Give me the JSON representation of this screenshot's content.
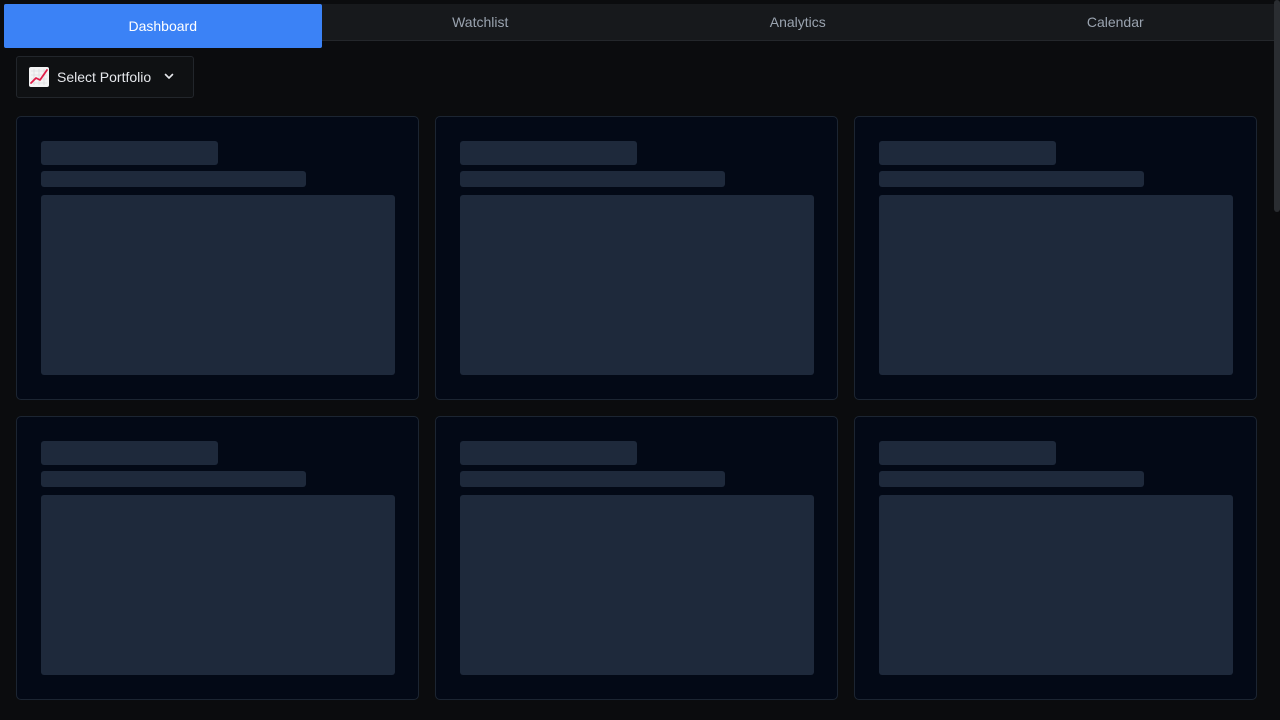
{
  "tabs": [
    {
      "label": "Dashboard",
      "active": true
    },
    {
      "label": "Watchlist",
      "active": false
    },
    {
      "label": "Analytics",
      "active": false
    },
    {
      "label": "Calendar",
      "active": false
    }
  ],
  "portfolio_select": {
    "label": "Select Portfolio",
    "icon": "chart-increasing-icon"
  },
  "colors": {
    "accent": "#3b82f6",
    "background": "#0b0c0e",
    "card": "#030916",
    "skeleton": "#1e293b"
  },
  "cards": [
    {
      "state": "loading"
    },
    {
      "state": "loading"
    },
    {
      "state": "loading"
    },
    {
      "state": "loading"
    },
    {
      "state": "loading"
    },
    {
      "state": "loading"
    }
  ]
}
